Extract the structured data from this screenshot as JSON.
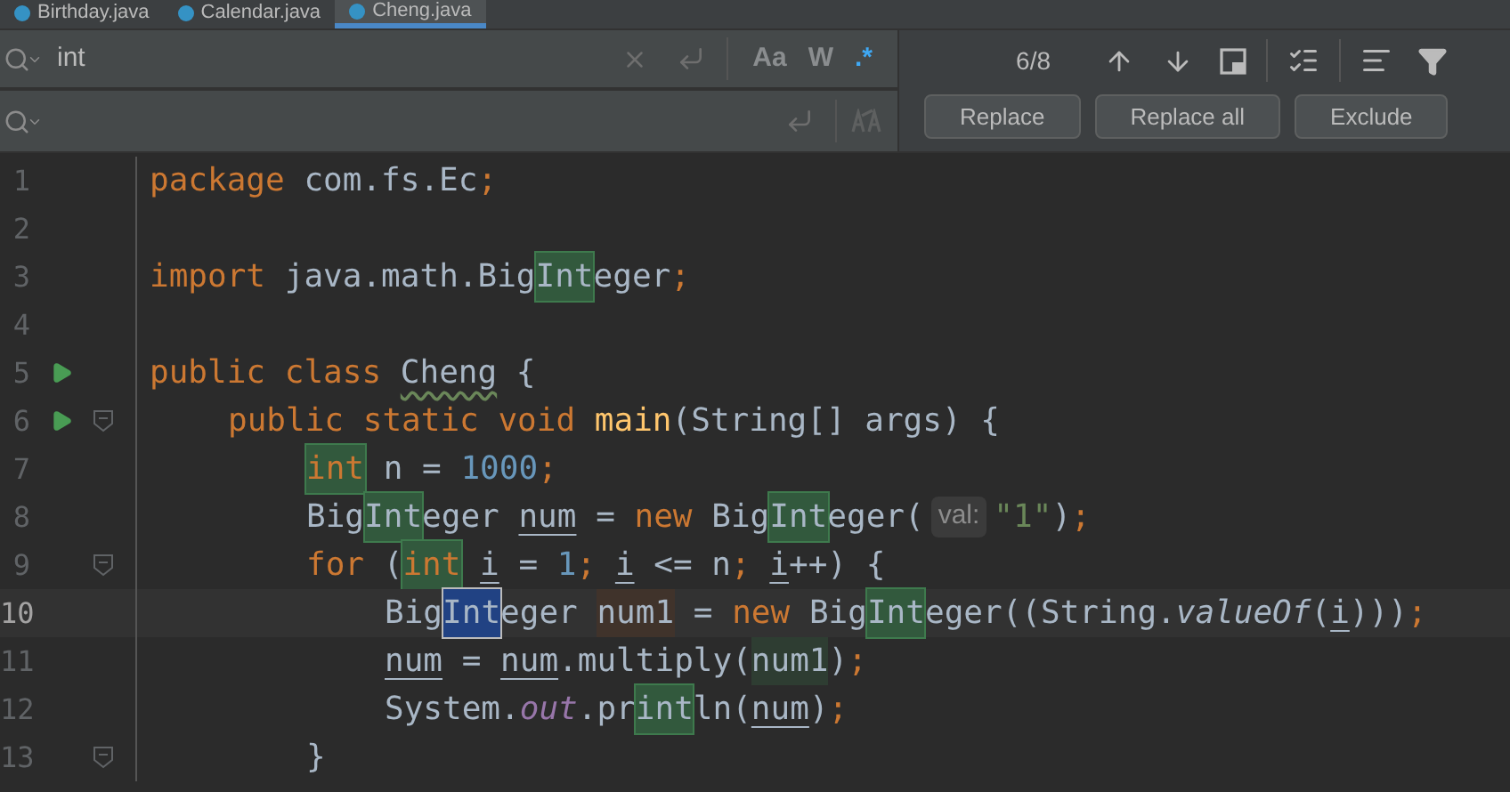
{
  "tabs": [
    {
      "label": "Birthday.java",
      "selected": false
    },
    {
      "label": "Calendar.java",
      "selected": false
    },
    {
      "label": "Cheng.java",
      "selected": true
    }
  ],
  "find": {
    "value": "int",
    "toggles": [
      {
        "label": "Aa",
        "selected": false
      },
      {
        "label": "W",
        "selected": false
      },
      {
        "label": ".*",
        "selected": true
      }
    ],
    "counter": "6/8"
  },
  "replace": {
    "buttons": [
      "Replace",
      "Replace all",
      "Exclude"
    ]
  },
  "editor": {
    "lines": [
      {
        "number": "1",
        "run": false,
        "fold": false,
        "current": false,
        "tokens": [
          {
            "text": "package",
            "kind": "keyword"
          },
          {
            "text": " com.fs.Ec",
            "kind": "plain"
          },
          {
            "text": ";",
            "kind": "keyword"
          }
        ]
      },
      {
        "number": "2",
        "run": false,
        "fold": false,
        "current": false
      },
      {
        "number": "3",
        "run": false,
        "fold": false,
        "current": false,
        "tokens": [
          {
            "text": "import",
            "kind": "keyword"
          },
          {
            "text": " java.math.Big",
            "kind": "plain"
          },
          {
            "text": "Int",
            "kind": "plain",
            "search_match": true
          },
          {
            "text": "eger",
            "kind": "plain"
          },
          {
            "text": ";",
            "kind": "keyword"
          }
        ]
      },
      {
        "number": "4",
        "run": false,
        "fold": false,
        "current": false
      },
      {
        "number": "5",
        "run": true,
        "fold": false,
        "current": false,
        "tokens": [
          {
            "text": "public class ",
            "kind": "keyword"
          },
          {
            "text": "Cheng",
            "kind": "plain",
            "typo": true
          },
          {
            "text": " {",
            "kind": "plain"
          }
        ],
        "children": [
          {
            "number": "6",
            "run": true,
            "fold": true,
            "current": false,
            "tokens": [
              {
                "text": "public static void ",
                "kind": "keyword"
              },
              {
                "text": "main",
                "kind": "method_decl"
              },
              {
                "text": "(String[] args) {",
                "kind": "plain"
              }
            ],
            "children": [
              {
                "number": "7",
                "run": false,
                "fold": false,
                "current": false,
                "tokens": [
                  {
                    "text": "int",
                    "kind": "keyword",
                    "search_match": true
                  },
                  {
                    "text": " n = ",
                    "kind": "plain"
                  },
                  {
                    "text": "1000",
                    "kind": "number"
                  },
                  {
                    "text": ";",
                    "kind": "keyword"
                  }
                ]
              },
              {
                "number": "8",
                "run": false,
                "fold": false,
                "current": false,
                "tokens": [
                  {
                    "text": "Big",
                    "kind": "plain"
                  },
                  {
                    "text": "Int",
                    "kind": "plain",
                    "search_match": true
                  },
                  {
                    "text": "eger ",
                    "kind": "plain"
                  },
                  {
                    "text": "num",
                    "kind": "plain",
                    "underlined": true
                  },
                  {
                    "text": " = ",
                    "kind": "plain"
                  },
                  {
                    "text": "new ",
                    "kind": "keyword"
                  },
                  {
                    "text": "Big",
                    "kind": "plain"
                  },
                  {
                    "text": "Int",
                    "kind": "plain",
                    "search_match": true
                  },
                  {
                    "text": "eger(",
                    "kind": "plain"
                  },
                  {
                    "text": "val:",
                    "kind": "hint"
                  },
                  {
                    "text": "\"1\"",
                    "kind": "string"
                  },
                  {
                    "text": ")",
                    "kind": "plain"
                  },
                  {
                    "text": ";",
                    "kind": "keyword"
                  }
                ]
              },
              {
                "number": "9",
                "run": false,
                "fold": true,
                "current": false,
                "tokens": [
                  {
                    "text": "for ",
                    "kind": "keyword"
                  },
                  {
                    "text": "(",
                    "kind": "plain"
                  },
                  {
                    "text": "int",
                    "kind": "keyword",
                    "search_match": true
                  },
                  {
                    "text": "i",
                    "kind": "plain",
                    "underlined": true,
                    "space_before": true
                  },
                  {
                    "text": " = ",
                    "kind": "plain"
                  },
                  {
                    "text": "1",
                    "kind": "number"
                  },
                  {
                    "text": "; ",
                    "kind": "keyword"
                  },
                  {
                    "text": "i",
                    "kind": "plain",
                    "underlined": true
                  },
                  {
                    "text": " <= n",
                    "kind": "plain"
                  },
                  {
                    "text": "; ",
                    "kind": "keyword"
                  },
                  {
                    "text": "i",
                    "kind": "plain",
                    "underlined": true
                  },
                  {
                    "text": "++) {",
                    "kind": "plain"
                  }
                ],
                "children": [
                  {
                    "number": "10",
                    "run": false,
                    "fold": false,
                    "current": true,
                    "tokens": [
                      {
                        "text": "Big",
                        "kind": "plain"
                      },
                      {
                        "text": "Int",
                        "kind": "plain",
                        "search_match": true,
                        "current_match": true
                      },
                      {
                        "text": "eger ",
                        "kind": "plain"
                      },
                      {
                        "text": "num1",
                        "kind": "plain",
                        "write_usage": true
                      },
                      {
                        "text": " = ",
                        "kind": "plain"
                      },
                      {
                        "text": "new ",
                        "kind": "keyword"
                      },
                      {
                        "text": "Big",
                        "kind": "plain"
                      },
                      {
                        "text": "Int",
                        "kind": "plain",
                        "search_match": true
                      },
                      {
                        "text": "eger((String.",
                        "kind": "plain"
                      },
                      {
                        "text": "valueOf",
                        "kind": "static_method"
                      },
                      {
                        "text": "(",
                        "kind": "plain"
                      },
                      {
                        "text": "i",
                        "kind": "plain",
                        "underlined": true
                      },
                      {
                        "text": ")))",
                        "kind": "plain"
                      },
                      {
                        "text": ";",
                        "kind": "keyword"
                      }
                    ]
                  },
                  {
                    "number": "11",
                    "run": false,
                    "fold": false,
                    "current": false,
                    "tokens": [
                      {
                        "text": "num",
                        "kind": "plain",
                        "underlined": true
                      },
                      {
                        "text": " = ",
                        "kind": "plain"
                      },
                      {
                        "text": "num",
                        "kind": "plain",
                        "underlined": true
                      },
                      {
                        "text": ".multiply(",
                        "kind": "plain"
                      },
                      {
                        "text": "num1",
                        "kind": "plain",
                        "read_usage": true
                      },
                      {
                        "text": ")",
                        "kind": "plain"
                      },
                      {
                        "text": ";",
                        "kind": "keyword"
                      }
                    ]
                  },
                  {
                    "number": "12",
                    "run": false,
                    "fold": false,
                    "current": false,
                    "tokens": [
                      {
                        "text": "System.",
                        "kind": "plain"
                      },
                      {
                        "text": "out",
                        "kind": "static_field"
                      },
                      {
                        "text": ".pr",
                        "kind": "plain"
                      },
                      {
                        "text": "int",
                        "kind": "plain",
                        "search_match": true
                      },
                      {
                        "text": "ln(",
                        "kind": "plain"
                      },
                      {
                        "text": "num",
                        "kind": "plain",
                        "underlined": true
                      },
                      {
                        "text": ")",
                        "kind": "plain"
                      },
                      {
                        "text": ";",
                        "kind": "keyword"
                      }
                    ]
                  }
                ]
              },
              {
                "number": "13",
                "run": false,
                "fold": true,
                "current": false,
                "tokens": [
                  {
                    "text": "}",
                    "kind": "plain"
                  }
                ]
              }
            ]
          }
        ]
      }
    ]
  }
}
